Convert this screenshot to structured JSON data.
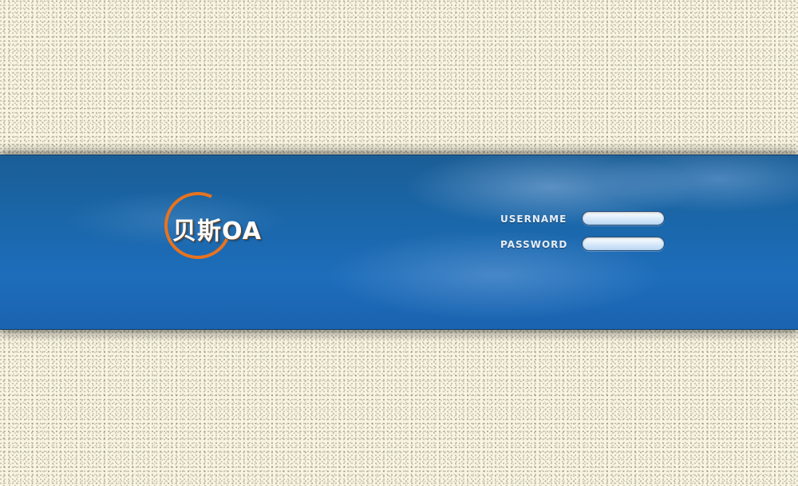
{
  "logo": {
    "text": "贝斯OA"
  },
  "login": {
    "username": {
      "label": "USERNAME",
      "value": ""
    },
    "password": {
      "label": "PASSWORD",
      "value": ""
    }
  },
  "colors": {
    "background": "#f8f4e2",
    "banner": "#1a66a8",
    "logo_ring": "#e8731e",
    "label_text": "#e8eef6",
    "input_fill": "#d8e9fa"
  }
}
